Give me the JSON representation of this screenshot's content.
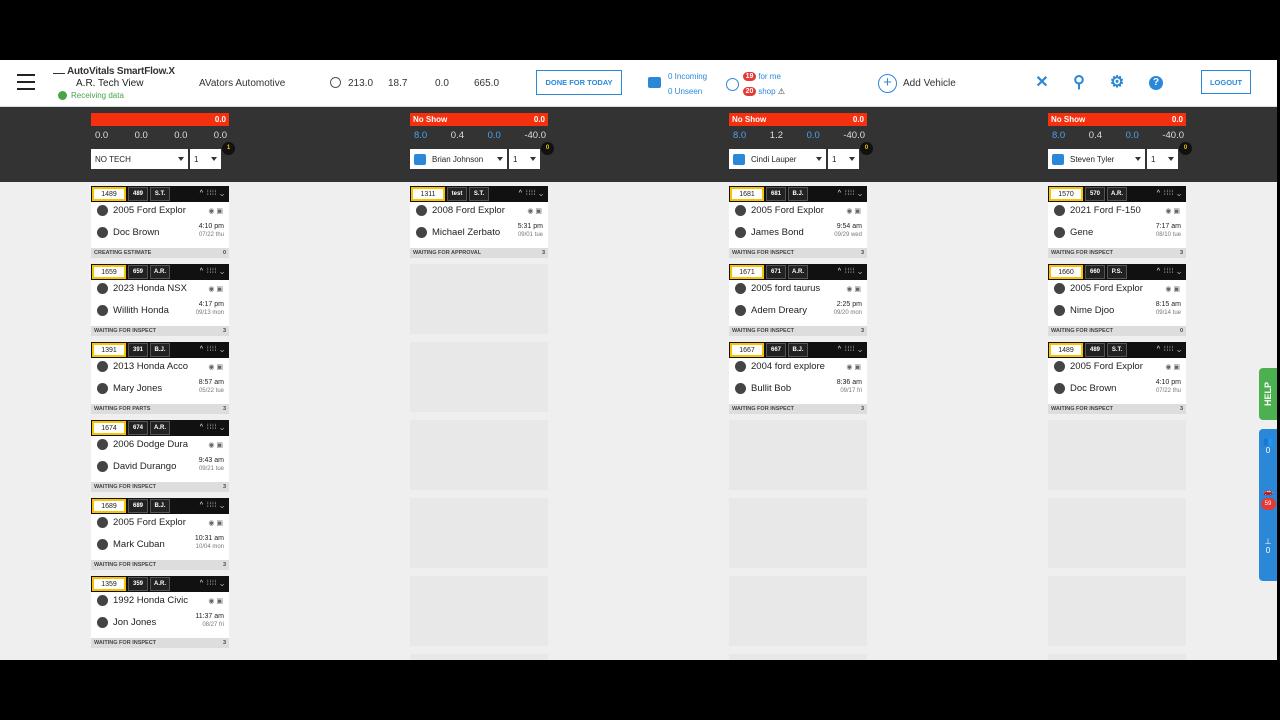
{
  "header": {
    "app": "AutoVitals SmartFlow.X",
    "view": "A.R. Tech View",
    "status": "Receiving data",
    "shop": "AVators Automotive",
    "stats": [
      "213.0",
      "18.7",
      "0.0",
      "665.0"
    ],
    "done_label": "DONE FOR TODAY",
    "incoming": "0 Incoming",
    "unseen": "0 Unseen",
    "forme_count": "19",
    "forme": "for me",
    "shop_count": "20",
    "shop_label": "shop",
    "add_vehicle": "Add Vehicle",
    "logout": "LOGOUT"
  },
  "columns": [
    {
      "status": "",
      "status_val": "0.0",
      "nums": [
        "0.0",
        "0.0",
        "0.0",
        "0.0"
      ],
      "tech": "NO TECH",
      "sel": "1",
      "count": "1",
      "msg": false,
      "cards": [
        {
          "ro": "1489",
          "t1": "489",
          "t2": "S.T.",
          "veh": "2005 Ford Explor",
          "cust": "Doc Brown",
          "time": "4:10 pm",
          "date": "07/22 thu",
          "st": "CREATING ESTIMATE",
          "n": "0"
        },
        {
          "ro": "1659",
          "t1": "659",
          "t2": "A.R.",
          "veh": "2023 Honda NSX",
          "cust": "Willith Honda",
          "time": "4:17 pm",
          "date": "09/13 mon",
          "st": "WAITING FOR INSPECT",
          "n": "3"
        },
        {
          "ro": "1391",
          "t1": "391",
          "t2": "B.J.",
          "veh": "2013 Honda Acco",
          "cust": "Mary Jones",
          "time": "8:57 am",
          "date": "05/22 tue",
          "st": "WAITING FOR PARTS",
          "n": "3"
        },
        {
          "ro": "1674",
          "t1": "674",
          "t2": "A.R.",
          "veh": "2006 Dodge Dura",
          "cust": "David Durango",
          "time": "9:43 am",
          "date": "09/21 tue",
          "st": "WAITING FOR INSPECT",
          "n": "3"
        },
        {
          "ro": "1689",
          "t1": "689",
          "t2": "B.J.",
          "veh": "2005 Ford Explor",
          "cust": "Mark Cuban",
          "time": "10:31 am",
          "date": "10/04 mon",
          "st": "WAITING FOR INSPECT",
          "n": "3"
        },
        {
          "ro": "1359",
          "t1": "359",
          "t2": "A.R.",
          "veh": "1992 Honda Civic",
          "cust": "Jon Jones",
          "time": "11:37 am",
          "date": "08/27 fri",
          "st": "WAITING FOR INSPECT",
          "n": "3"
        }
      ]
    },
    {
      "status": "No Show",
      "status_val": "0.0",
      "nums": [
        "8.0",
        "0.4",
        "0.0",
        "-40.0"
      ],
      "tech": "Brian Johnson",
      "sel": "1",
      "count": "0",
      "msg": true,
      "cards": [
        {
          "ro": "1311",
          "t1": "test",
          "t2": "S.T.",
          "veh": "2008 Ford Explor",
          "cust": "Michael Zerbato",
          "time": "5:31 pm",
          "date": "09/01 tue",
          "st": "WAITING FOR APPROVAL",
          "n": "3"
        }
      ]
    },
    {
      "status": "No Show",
      "status_val": "0.0",
      "nums": [
        "8.0",
        "1.2",
        "0.0",
        "-40.0"
      ],
      "tech": "Cindi Lauper",
      "sel": "1",
      "count": "0",
      "msg": true,
      "cards": [
        {
          "ro": "1681",
          "t1": "681",
          "t2": "B.J.",
          "veh": "2005 Ford Explor",
          "cust": "James Bond",
          "time": "9:54 am",
          "date": "09/29 wed",
          "st": "WAITING FOR INSPECT",
          "n": "3"
        },
        {
          "ro": "1671",
          "t1": "671",
          "t2": "A.R.",
          "veh": "2005 ford taurus",
          "cust": "Adem Dreary",
          "time": "2:25 pm",
          "date": "09/20 mon",
          "st": "WAITING FOR INSPECT",
          "n": "3"
        },
        {
          "ro": "1667",
          "t1": "667",
          "t2": "B.J.",
          "veh": "2004 ford explore",
          "cust": "Bullit Bob",
          "time": "8:36 am",
          "date": "09/17 fri",
          "st": "WAITING FOR INSPECT",
          "n": "3"
        }
      ]
    },
    {
      "status": "No Show",
      "status_val": "0.0",
      "nums": [
        "8.0",
        "0.4",
        "0.0",
        "-40.0"
      ],
      "tech": "Steven Tyler",
      "sel": "1",
      "count": "0",
      "msg": true,
      "cards": [
        {
          "ro": "1570",
          "t1": "570",
          "t2": "A.R.",
          "veh": "2021 Ford F-150",
          "cust": "Gene",
          "time": "7:17 am",
          "date": "08/10 tue",
          "st": "WAITING FOR INSPECT",
          "n": "3"
        },
        {
          "ro": "1660",
          "t1": "660",
          "t2": "P.S.",
          "veh": "2005 Ford Explor",
          "cust": "Nime Djoo",
          "time": "8:15 am",
          "date": "09/14 tue",
          "st": "WAITING FOR INSPECT",
          "n": "0"
        },
        {
          "ro": "1489",
          "t1": "489",
          "t2": "S.T.",
          "veh": "2005 Ford Explor",
          "cust": "Doc Brown",
          "time": "4:10 pm",
          "date": "07/22 thu",
          "st": "WAITING FOR INSPECT",
          "n": "3"
        }
      ]
    }
  ],
  "sidebar": {
    "help": "HELP",
    "a": "0",
    "b": "59",
    "c": "0"
  },
  "colors": {
    "accent": "#2b88d8",
    "status_red": "#f4300f",
    "ro_border": "#f9c200"
  }
}
